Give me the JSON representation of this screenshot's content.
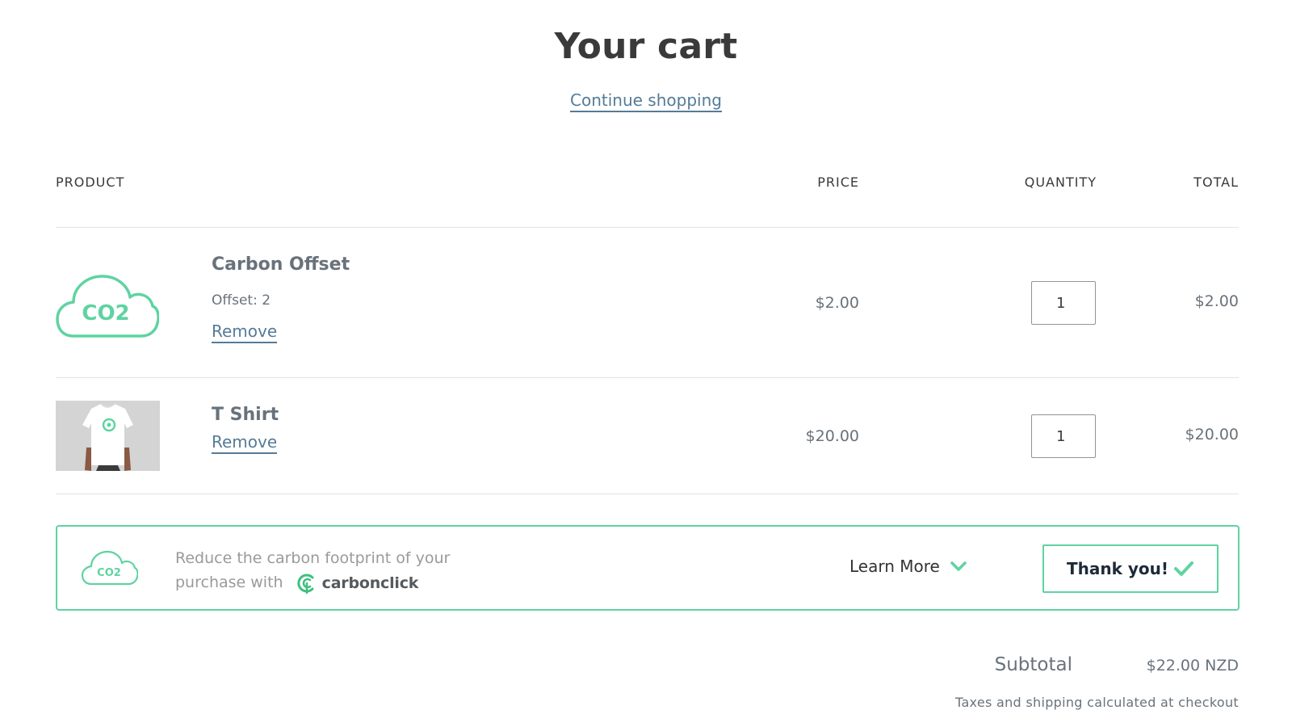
{
  "page": {
    "title": "Your cart",
    "continue_label": "Continue shopping"
  },
  "table": {
    "headers": {
      "product": "PRODUCT",
      "price": "PRICE",
      "quantity": "QUANTITY",
      "total": "TOTAL"
    },
    "rows": [
      {
        "name": "Carbon Offset",
        "meta": "Offset: 2",
        "remove_label": "Remove",
        "price": "$2.00",
        "quantity": "1",
        "total": "$2.00",
        "image": "co2-cloud-icon",
        "image_text": "CO2"
      },
      {
        "name": "T Shirt",
        "remove_label": "Remove",
        "price": "$20.00",
        "quantity": "1",
        "total": "$20.00",
        "image": "white-t-shirt-photo"
      }
    ]
  },
  "carbon_banner": {
    "icon": "co2-cloud-icon",
    "icon_text": "CO2",
    "text_line1": "Reduce the carbon footprint of your",
    "text_line2": "purchase with",
    "brand_name": "carbonclick",
    "learn_more_label": "Learn More",
    "thank_you_label": "Thank you!"
  },
  "summary": {
    "subtotal_label": "Subtotal",
    "subtotal_value": "$22.00 NZD",
    "tax_note": "Taxes and shipping calculated at checkout"
  },
  "colors": {
    "accent_green": "#5fd3a1",
    "link_blue": "#557b97",
    "text_dark": "#3a3a3a",
    "text_muted": "#69727b"
  }
}
